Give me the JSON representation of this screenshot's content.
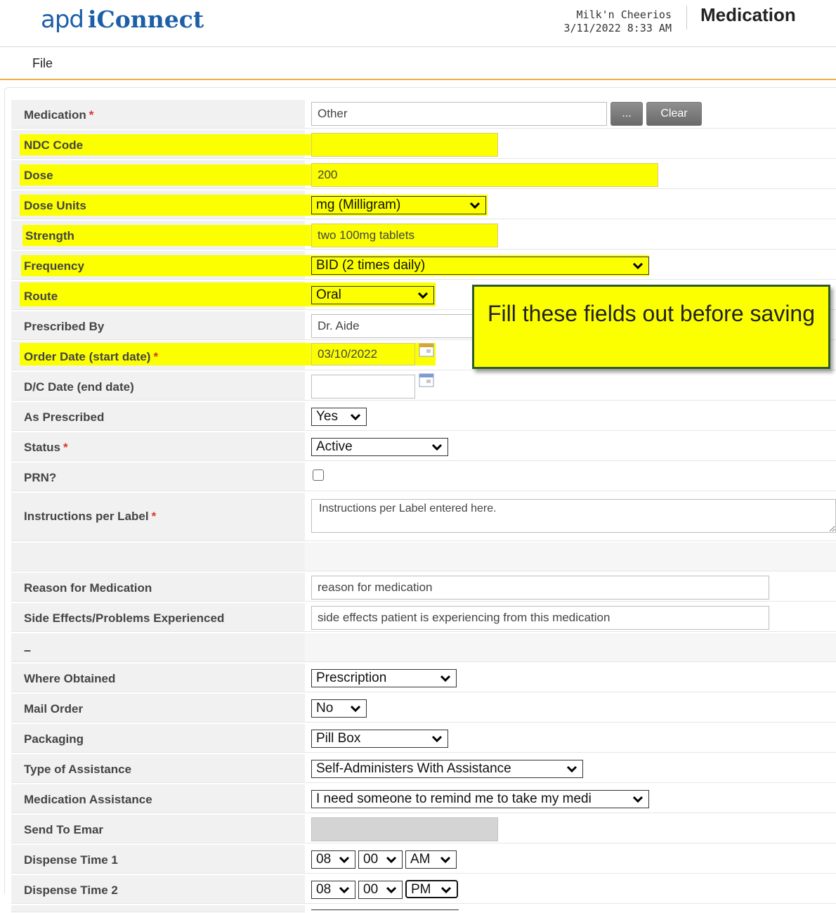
{
  "header": {
    "logo_apd": "apd",
    "logo_iconnect": "iConnect",
    "user_name": "Milk'n Cheerios",
    "datetime": "3/11/2022 8:33 AM",
    "page_title": "Medication"
  },
  "menu": {
    "file": "File"
  },
  "required_mark": "*",
  "form": {
    "medication": {
      "label": "Medication",
      "value": "Other",
      "browse_label": "...",
      "clear_label": "Clear"
    },
    "ndc_code": {
      "label": "NDC Code",
      "value": ""
    },
    "dose": {
      "label": "Dose",
      "value": "200"
    },
    "dose_units": {
      "label": "Dose Units",
      "value": "mg (Milligram)"
    },
    "strength": {
      "label": "Strength",
      "value": "two 100mg tablets"
    },
    "frequency": {
      "label": "Frequency",
      "value": "BID (2 times daily)"
    },
    "route": {
      "label": "Route",
      "value": "Oral"
    },
    "prescribed_by": {
      "label": "Prescribed By",
      "value": "Dr. Aide"
    },
    "order_date": {
      "label": "Order Date (start date)",
      "value": "03/10/2022"
    },
    "dc_date": {
      "label": "D/C Date (end date)",
      "value": ""
    },
    "as_prescribed": {
      "label": "As Prescribed",
      "value": "Yes"
    },
    "status": {
      "label": "Status",
      "value": "Active"
    },
    "prn": {
      "label": "PRN?",
      "checked": false
    },
    "instructions": {
      "label": "Instructions per Label",
      "value": "Instructions per Label entered here."
    },
    "reason": {
      "label": "Reason for Medication",
      "value": "reason for medication"
    },
    "side_effects": {
      "label": "Side Effects/Problems Experienced",
      "value": "side effects patient is experiencing from this medication"
    },
    "section_dash": "–",
    "where_obtained": {
      "label": "Where Obtained",
      "value": "Prescription"
    },
    "mail_order": {
      "label": "Mail Order",
      "value": "No"
    },
    "packaging": {
      "label": "Packaging",
      "value": "Pill Box"
    },
    "type_of_assistance": {
      "label": "Type of Assistance",
      "value": "Self-Administers With Assistance"
    },
    "medication_assistance": {
      "label": "Medication Assistance",
      "value": "I need someone to remind me to take my medi"
    },
    "send_to_emar": {
      "label": "Send To Emar",
      "value": ""
    },
    "dispense_time_1": {
      "label": "Dispense Time 1",
      "hour": "08",
      "minute": "00",
      "ampm": "AM"
    },
    "dispense_time_2": {
      "label": "Dispense Time 2",
      "hour": "08",
      "minute": "00",
      "ampm": "PM"
    }
  },
  "callout": {
    "text": "Fill these fields out before saving"
  },
  "colors": {
    "highlight": "#fbff00",
    "brand_blue": "#1c5fa8",
    "accent_orange": "#f0b04a",
    "required_red": "#d9362b",
    "callout_border": "#2f5a28"
  }
}
